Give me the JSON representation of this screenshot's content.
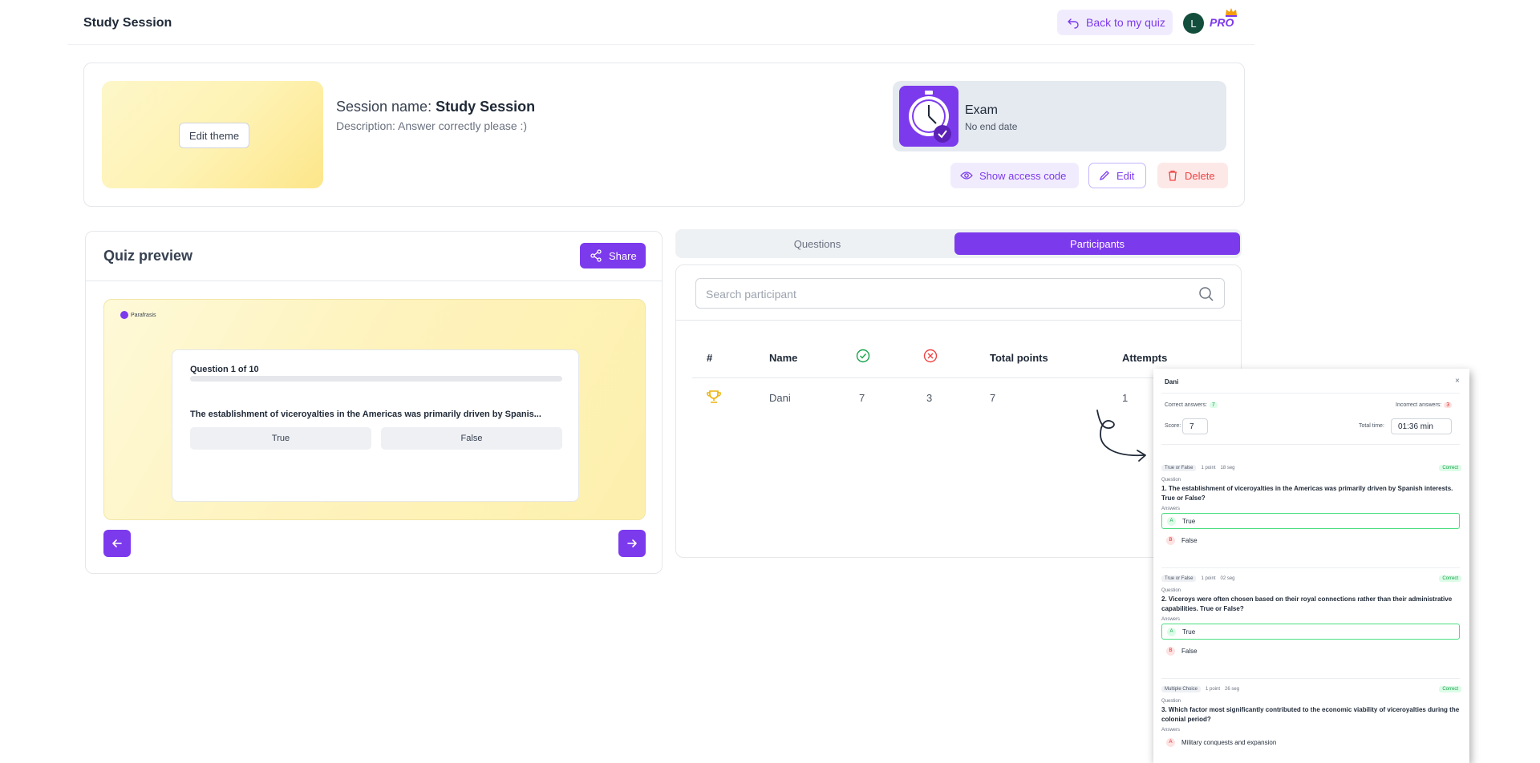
{
  "header": {
    "title": "Study Session",
    "back_label": "Back to my quiz",
    "avatar_initial": "L",
    "plan_label": "PRO"
  },
  "session": {
    "name_prefix": "Session name: ",
    "name": "Study Session",
    "description": "Description: Answer correctly please :)",
    "edit_theme_label": "Edit theme",
    "mode_title": "Exam",
    "mode_subtitle": "No end date",
    "show_access_code_label": "Show access code",
    "edit_label": "Edit",
    "delete_label": "Delete"
  },
  "preview": {
    "title": "Quiz preview",
    "share_label": "Share",
    "brand": "Parafrasis",
    "question_counter": "Question 1 of 10",
    "question_text": "The establishment of viceroyalties in the Americas was primarily driven by Spanis...",
    "options": [
      "True",
      "False"
    ]
  },
  "tabs": {
    "questions": "Questions",
    "participants": "Participants"
  },
  "participants": {
    "search_placeholder": "Search participant",
    "columns": {
      "rank": "#",
      "name": "Name",
      "total_points": "Total points",
      "attempts": "Attempts"
    },
    "rows": [
      {
        "name": "Dani",
        "correct": "7",
        "incorrect": "3",
        "total_points": "7",
        "attempts": "1"
      }
    ]
  },
  "detail": {
    "name": "Dani",
    "close": "×",
    "correct_label": "Correct answers:",
    "correct_value": "7",
    "incorrect_label": "Incorrect answers:",
    "incorrect_value": "3",
    "score_label": "Score:",
    "score_value": "7",
    "time_label": "Total time:",
    "time_value": "01:36 min",
    "question_label": "Question",
    "answers_label": "Answers",
    "questions": [
      {
        "type": "True or False",
        "points": "1 point",
        "time": "18 seg",
        "status": "Correct",
        "text": "1. The establishment of viceroyalties in the Americas was primarily driven by Spanish interests. True or False?",
        "answers": [
          {
            "letter": "A",
            "text": "True"
          },
          {
            "letter": "B",
            "text": "False"
          }
        ]
      },
      {
        "type": "True or False",
        "points": "1 point",
        "time": "02 seg",
        "status": "Correct",
        "text": "2. Viceroys were often chosen based on their royal connections rather than their administrative capabilities. True or False?",
        "answers": [
          {
            "letter": "A",
            "text": "True"
          },
          {
            "letter": "B",
            "text": "False"
          }
        ]
      },
      {
        "type": "Multiple Choice",
        "points": "1 point",
        "time": "26 seg",
        "status": "Correct",
        "text": "3. Which factor most significantly contributed to the economic viability of viceroyalties during the colonial period?",
        "answers": [
          {
            "letter": "A",
            "text": "Military conquests and expansion"
          }
        ]
      }
    ]
  },
  "colors": {
    "accent": "#7c3aed",
    "success": "#16a34a",
    "danger": "#ef4444",
    "trophy": "#eab308"
  }
}
